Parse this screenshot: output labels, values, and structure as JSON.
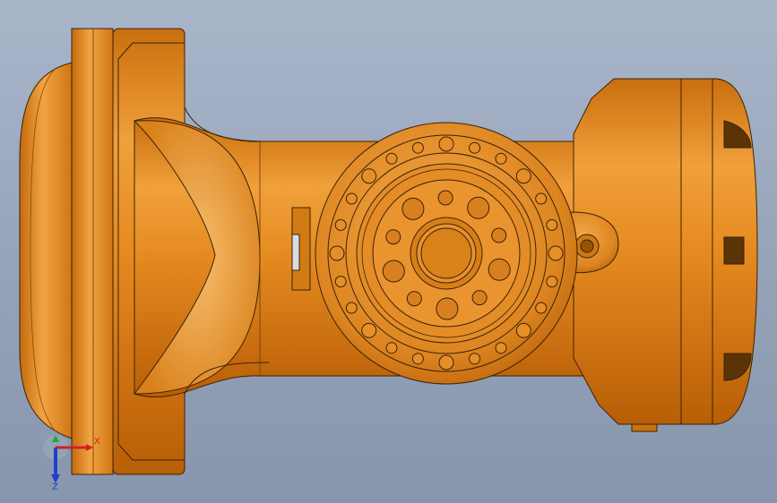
{
  "viewport": {
    "model": "robot-arm-housing",
    "body_color": "#e0861c",
    "body_highlight": "#f4a640",
    "body_shadow": "#b65f08",
    "edge_color": "#3a2208"
  },
  "triad": {
    "x_label": "X",
    "y_label": "",
    "z_label": "Z",
    "x_color": "#d42020",
    "y_color": "#1faa2a",
    "z_color": "#2040c8"
  }
}
